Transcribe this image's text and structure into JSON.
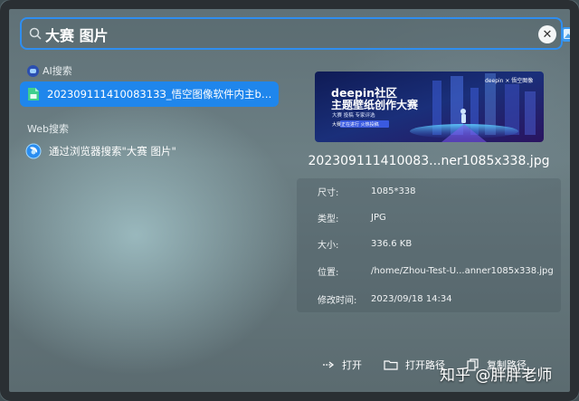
{
  "search": {
    "value": "大赛 图片",
    "placeholder": ""
  },
  "groups": {
    "ai": {
      "label": "AI搜索"
    },
    "web": {
      "label": "Web搜索"
    }
  },
  "results": {
    "selected": {
      "label": "20230911141008313З_悟空图像软件内主bann..."
    },
    "web": {
      "label": "通过浏览器搜索\"大赛 图片\""
    }
  },
  "preview": {
    "image": {
      "brand": "deepin社区",
      "headline": "主题壁纸创作大赛",
      "logo_text": "deepin × 悟空图像",
      "sub": "大赛 投稿 专家评选",
      "badge": "大赛正在进行 火热投稿"
    },
    "title": "202309111410083...ner1085x338.jpg",
    "properties": [
      {
        "key": "尺寸:",
        "value": "1085*338"
      },
      {
        "key": "类型:",
        "value": "JPG"
      },
      {
        "key": "大小:",
        "value": "336.6 KB"
      },
      {
        "key": "位置:",
        "value": "/home/Zhou-Test-U...anner1085x338.jpg"
      },
      {
        "key": "修改时间:",
        "value": "2023/09/18 14:34"
      }
    ]
  },
  "actions": {
    "open": "打开",
    "open_path": "打开路径",
    "copy_path": "复制路径"
  },
  "watermark": "知乎 @胖胖老师",
  "colors": {
    "accent": "#1f86ec",
    "focus_border": "#2f8ef0"
  }
}
